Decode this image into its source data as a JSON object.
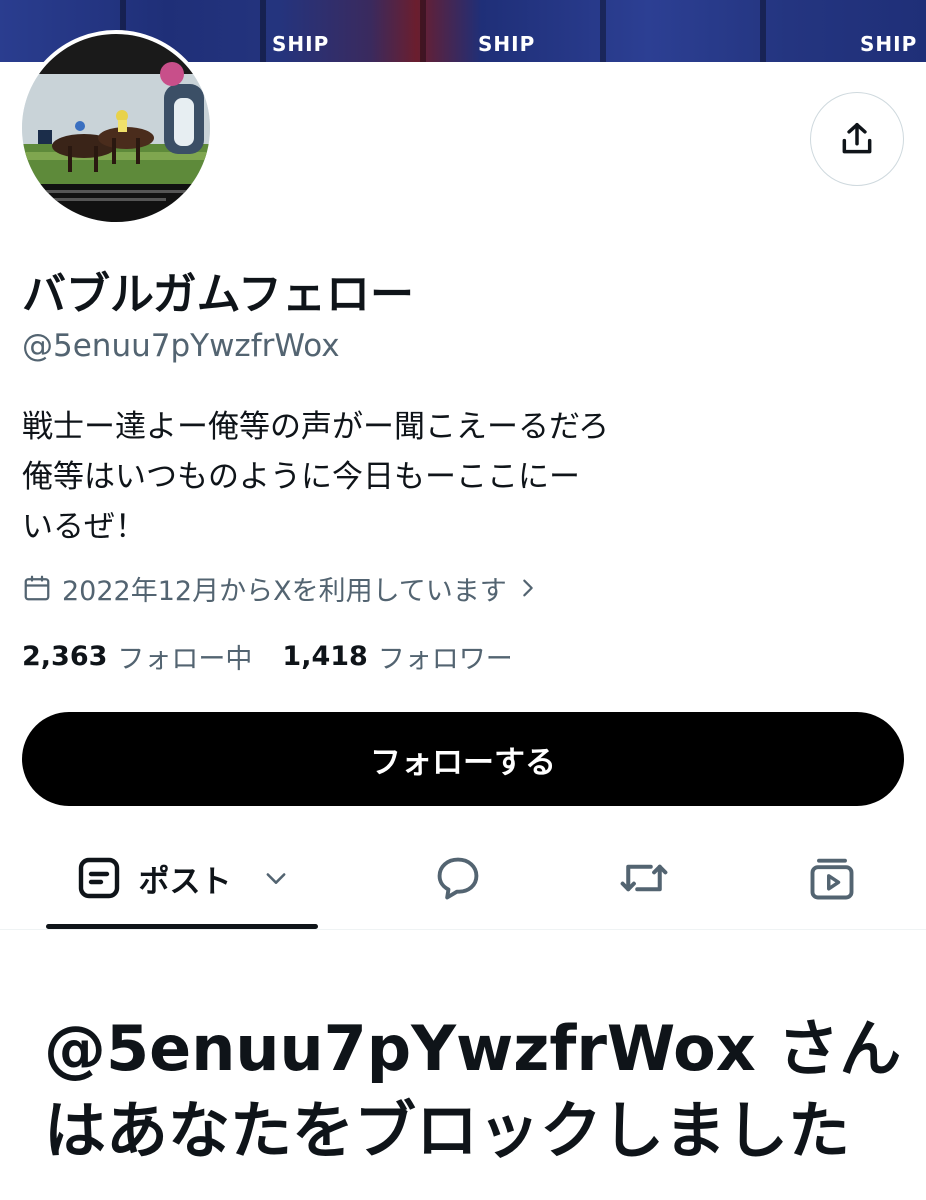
{
  "banner": {
    "sponsors": [
      "SHIP",
      "SHIP",
      "SHIP"
    ]
  },
  "profile": {
    "display_name": "バブルガムフェロー",
    "handle": "@5enuu7pYwzfrWox",
    "bio_lines": [
      "戦士ー達よー俺等の声がー聞こえーるだろ",
      "俺等はいつものように今日もーここにー",
      "いるぜ！"
    ],
    "joined": "2022年12月からXを利用しています"
  },
  "stats": {
    "following_count": "2,363",
    "following_label": "フォロー中",
    "followers_count": "1,418",
    "followers_label": "フォロワー"
  },
  "actions": {
    "follow_label": "フォローする"
  },
  "tabs": {
    "posts_label": "ポスト",
    "icons": [
      "posts-icon",
      "replies-icon",
      "reposts-icon",
      "media-icon"
    ]
  },
  "blocked_notice": {
    "line1": "@5enuu7pYwzfrWox さん",
    "line2": "はあなたをブロックしました"
  },
  "colors": {
    "primary_text": "#0f1419",
    "secondary_text": "#536471",
    "button_bg": "#000000",
    "border": "#cfd9de"
  }
}
